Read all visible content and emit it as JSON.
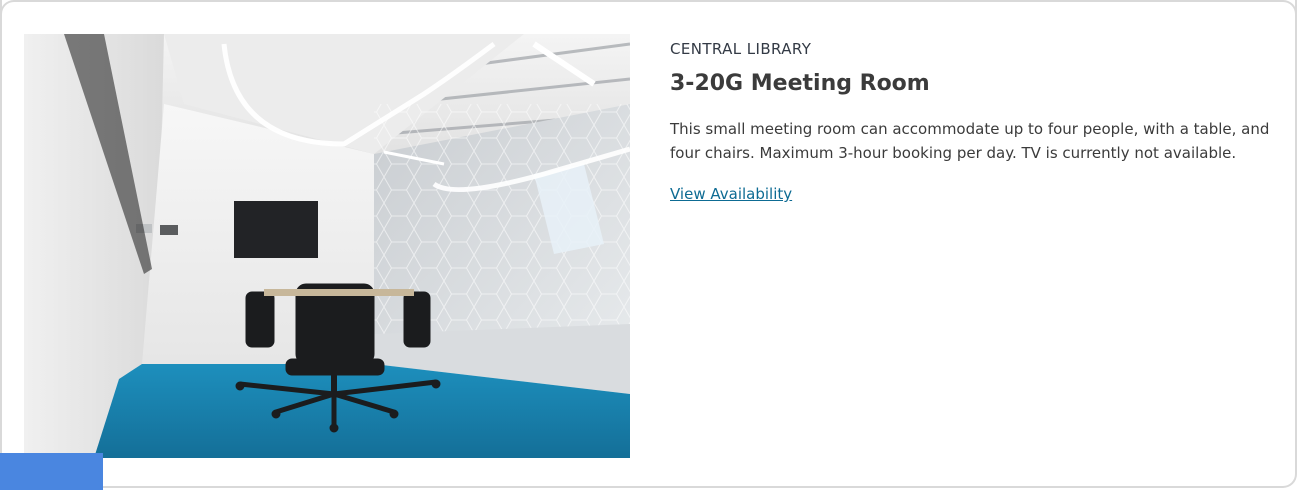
{
  "room": {
    "location": "CENTRAL LIBRARY",
    "title": "3-20G Meeting Room",
    "description": "This small meeting room can accommodate up to four people, with a table, and four chairs. Maximum 3-hour booking per day. TV is currently not available.",
    "availability_link": "View Availability"
  },
  "colors": {
    "link": "#0d6b93",
    "carpet": "#1a84b0",
    "corner_tab": "#4a86e0"
  }
}
